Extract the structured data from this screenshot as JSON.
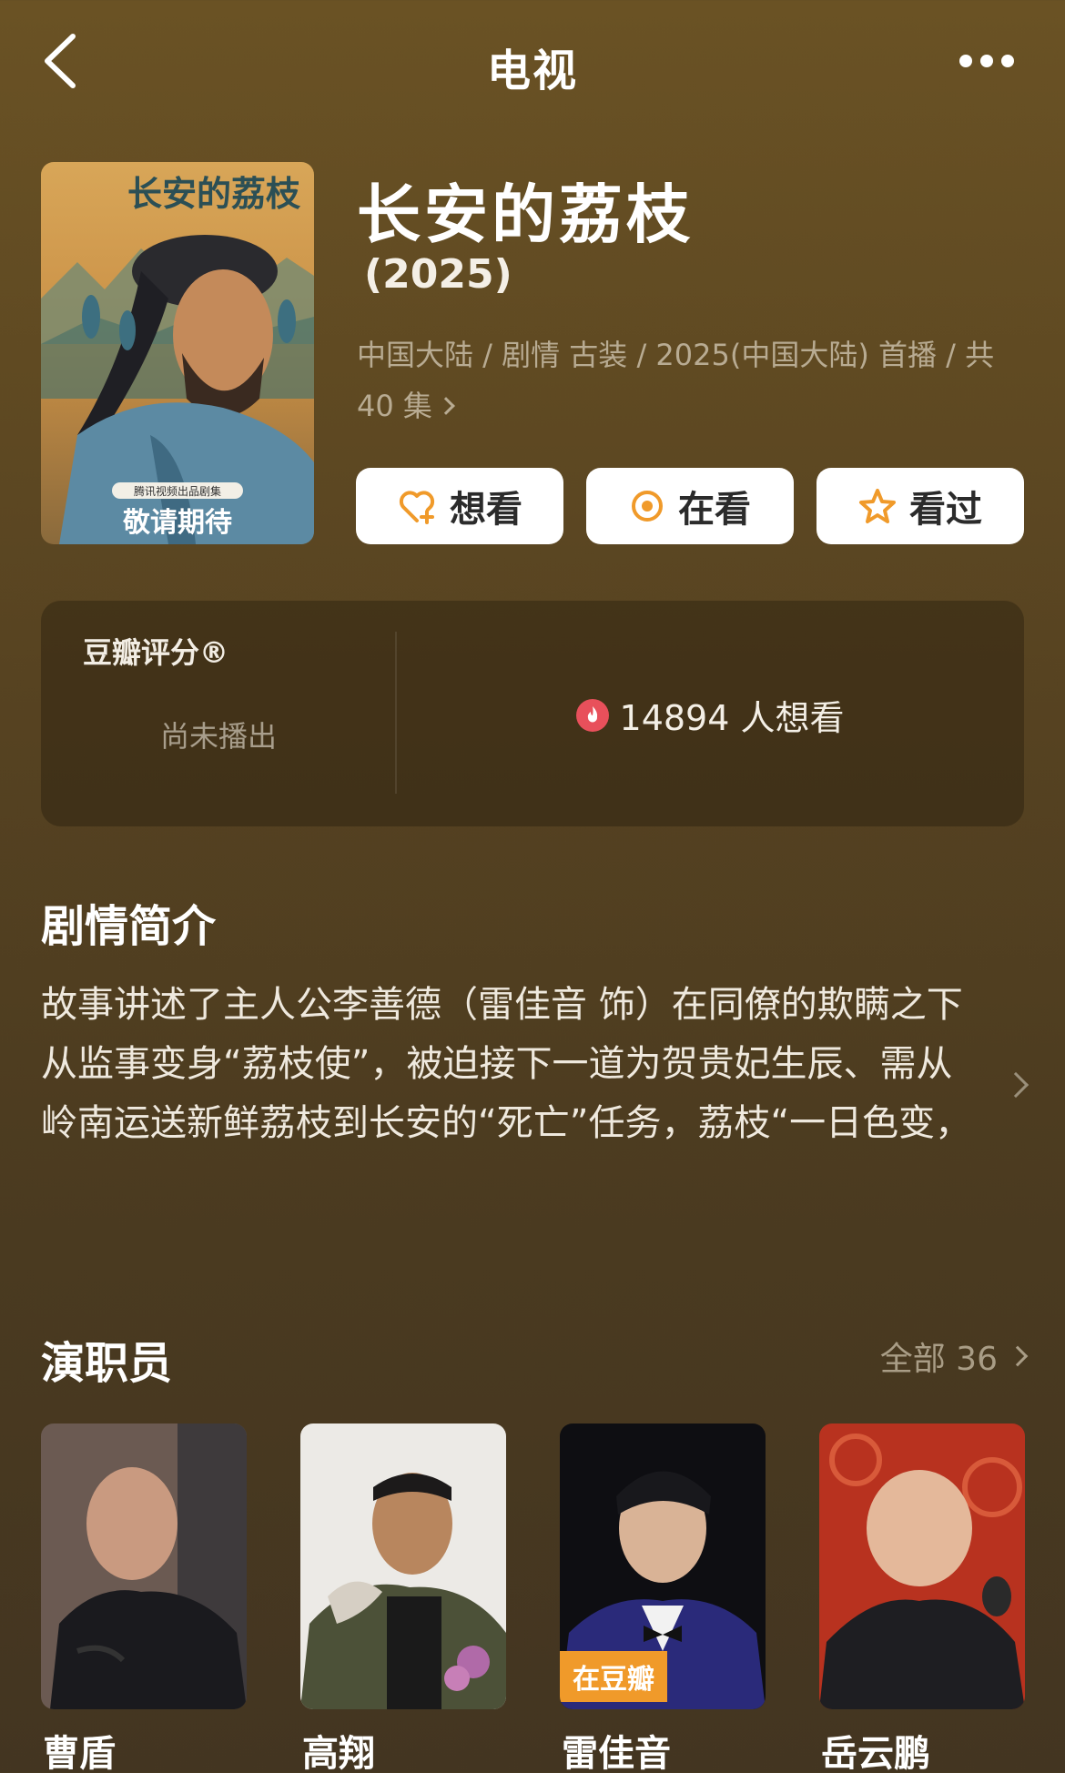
{
  "header": {
    "title": "电视"
  },
  "movie": {
    "title": "长安的荔枝",
    "year": "(2025)",
    "meta_line1": "中国大陆 / 剧情 古装 / 2025(中国大陆) 首播 / 共",
    "meta_line2": "40 集",
    "poster": {
      "title_art": "长安的荔枝",
      "presenter": "腾讯视频出品剧集",
      "tagline": "敬请期待"
    }
  },
  "actions": [
    {
      "label": "想看",
      "icon": "heart-plus-icon"
    },
    {
      "label": "在看",
      "icon": "target-icon"
    },
    {
      "label": "看过",
      "icon": "star-icon"
    }
  ],
  "rating": {
    "label": "豆瓣评分®",
    "status": "尚未播出",
    "want_count": "14894 人想看"
  },
  "synopsis": {
    "title": "剧情简介",
    "text": "故事讲述了主人公李善德（雷佳音 饰）在同僚的欺瞒之下从监事变身“荔枝使”，被迫接下一道为贺贵妃生辰、需从岭南运送新鲜荔枝到长安的“死亡”任务，荔枝“一日色变，两日香变，三日味变”，而..."
  },
  "cast": {
    "title": "演职员",
    "all_label": "全部 36",
    "members": [
      {
        "name": "曹盾"
      },
      {
        "name": "高翔"
      },
      {
        "name": "雷佳音",
        "badge": "在豆瓣"
      },
      {
        "name": "岳云鹏"
      }
    ]
  },
  "colors": {
    "background": "#574321",
    "accent": "#f09a2a",
    "fire": "#e8505b"
  }
}
